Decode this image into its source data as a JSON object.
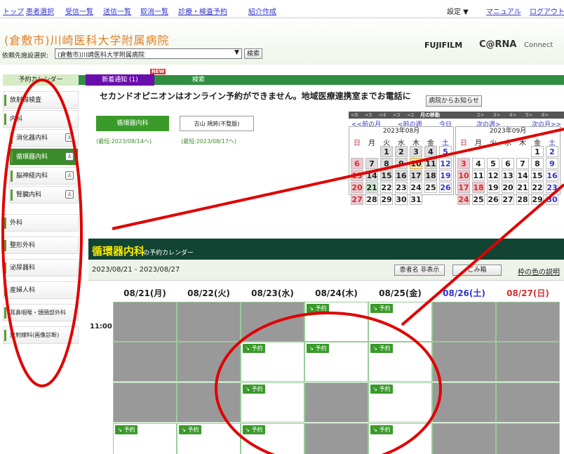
{
  "nav": {
    "links": [
      "トップ",
      "患者選択",
      "受信一覧",
      "送信一覧",
      "取消一覧",
      "診療・検査予約",
      "紹介作成"
    ],
    "right": [
      "設定 ▼",
      "マニュアル",
      "ログアウト"
    ]
  },
  "header": {
    "hospital": "(倉敷市)川崎医科大学附属病院",
    "request_label": "依頼先施設選択:",
    "select_value": "(倉敷市)川崎医科大学附属病院",
    "search_btn": "検索",
    "brand1": "FUJIFILM",
    "brand2": "C@RNA",
    "brand3": "Connect"
  },
  "sidebar": {
    "title": "予約カレンダー",
    "items": [
      "放射線検査",
      "内科",
      "消化器内科",
      "循環器内科",
      "脳神経内科",
      "腎臓内科",
      "外科",
      "整形外科",
      "泌尿器科",
      "産婦人科",
      "耳鼻咽喉・頭頸部外科",
      "放射線科(画像診断)"
    ]
  },
  "tabs": {
    "new": "新着通知 (1)",
    "new_badge": "NEW",
    "search": "検索"
  },
  "notice": "セカンドオピニオンはオンライン予約ができません。地域医療連携室までお電話にてご",
  "hospital_notice_btn": "病院からお知らせ",
  "depts": [
    {
      "name": "循環器内科",
      "last": "(最短:2023/08/14へ)"
    },
    {
      "name": "古山 規將(不整脈)",
      "last": "(最短:2023/08/17へ)"
    }
  ],
  "move": {
    "prev": [
      "<6",
      "<5",
      "<4",
      "<3",
      "<2"
    ],
    "label": "月の移動",
    "next": [
      "2>",
      "3>",
      "4>",
      "5>",
      "6>"
    ],
    "links": [
      "<<前の月",
      "<前の週",
      "今日",
      "次の週>",
      "次の月>>"
    ]
  },
  "cal": [
    {
      "title": "2023年08月",
      "weekdays": [
        "日",
        "月",
        "火",
        "水",
        "木",
        "金",
        "土"
      ],
      "days": [
        "",
        "",
        "1",
        "2",
        "3",
        "4",
        "5",
        "6",
        "7",
        "8",
        "9",
        "10",
        "11",
        "12",
        "13",
        "14",
        "15",
        "16",
        "17",
        "18",
        "19",
        "20",
        "21",
        "22",
        "23",
        "24",
        "25",
        "26",
        "27",
        "28",
        "29",
        "30",
        "31",
        "",
        ""
      ]
    },
    {
      "title": "2023年09月",
      "weekdays": [
        "日",
        "月",
        "火",
        "水",
        "木",
        "金",
        "土"
      ],
      "days": [
        "",
        "",
        "",
        "",
        "",
        "1",
        "2",
        "3",
        "4",
        "5",
        "6",
        "7",
        "8",
        "9",
        "10",
        "11",
        "12",
        "13",
        "14",
        "15",
        "16",
        "17",
        "18",
        "19",
        "20",
        "21",
        "22",
        "23",
        "24",
        "25",
        "26",
        "27",
        "28",
        "29",
        "30"
      ]
    }
  ],
  "calendar": {
    "title": "循環器内科",
    "title_suffix": "の予約カレンダー",
    "range": "2023/08/21 - 2023/08/27",
    "btn_hide": "患者名 非表示",
    "btn_trash": "ごみ箱",
    "legend_link": "枠の色の説明",
    "time": "11:00",
    "cols": [
      "08/21(月)",
      "08/22(火)",
      "08/23(水)",
      "08/24(木)",
      "08/25(金)",
      "08/26(土)",
      "08/27(日)"
    ],
    "reserve": "予約"
  },
  "colors": {
    "green": "#3a8a2a",
    "red": "#e00000",
    "title_bg": "#114433"
  }
}
